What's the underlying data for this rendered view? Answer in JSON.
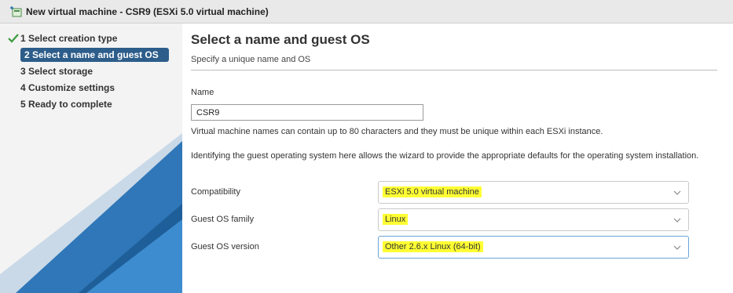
{
  "window": {
    "title": "New virtual machine - CSR9 (ESXi 5.0 virtual machine)"
  },
  "steps": [
    {
      "label": "1 Select creation type",
      "state": "done"
    },
    {
      "label": "2 Select a name and guest OS",
      "state": "active"
    },
    {
      "label": "3 Select storage",
      "state": "pending"
    },
    {
      "label": "4 Customize settings",
      "state": "pending"
    },
    {
      "label": "5 Ready to complete",
      "state": "pending"
    }
  ],
  "page": {
    "title": "Select a name and guest OS",
    "subtitle": "Specify a unique name and OS",
    "name_label": "Name",
    "name_value": "CSR9",
    "name_help": "Virtual machine names can contain up to 80 characters and they must be unique within each ESXi instance.",
    "os_help": "Identifying the guest operating system here allows the wizard to provide the appropriate defaults for the operating system installation.",
    "compatibility_label": "Compatibility",
    "compatibility_value": "ESXi 5.0 virtual machine",
    "os_family_label": "Guest OS family",
    "os_family_value": "Linux",
    "os_version_label": "Guest OS version",
    "os_version_value": "Other 2.6.x Linux (64-bit)"
  },
  "colors": {
    "active_step": "#2d5d8a",
    "highlight": "#ffff33",
    "check": "#3c9a3c",
    "decor_blue": "#2f77b8"
  },
  "icons": {
    "title": "vm-wizard-icon",
    "done": "checkmark-icon",
    "dropdown": "chevron-down-icon"
  }
}
